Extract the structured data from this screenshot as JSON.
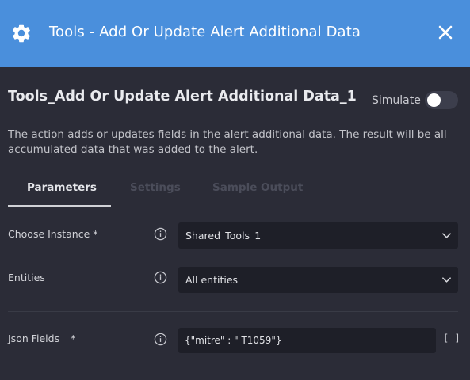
{
  "header": {
    "title": "Tools - Add Or Update Alert Additional Data",
    "icon": "gear-icon",
    "close_icon": "close-icon",
    "background_color": "#4a8fdc"
  },
  "action": {
    "name": "Tools_Add Or Update Alert Additional Data_1",
    "simulate_label": "Simulate",
    "simulate_on": false,
    "description": "The action adds or updates fields in the alert additional data. The result will be all accumulated data that was added to the alert."
  },
  "tabs": [
    {
      "label": "Parameters",
      "active": true
    },
    {
      "label": "Settings",
      "active": false
    },
    {
      "label": "Sample Output",
      "active": false
    }
  ],
  "params": {
    "instance": {
      "label": "Choose Instance *",
      "value": "Shared_Tools_1"
    },
    "entities": {
      "label": "Entities",
      "value": "All entities"
    },
    "json_fields": {
      "label": "Json Fields",
      "required_mark": "*",
      "value": "{\"mitre\" : \" T1059\"}",
      "expand_label": "[ ]"
    }
  }
}
